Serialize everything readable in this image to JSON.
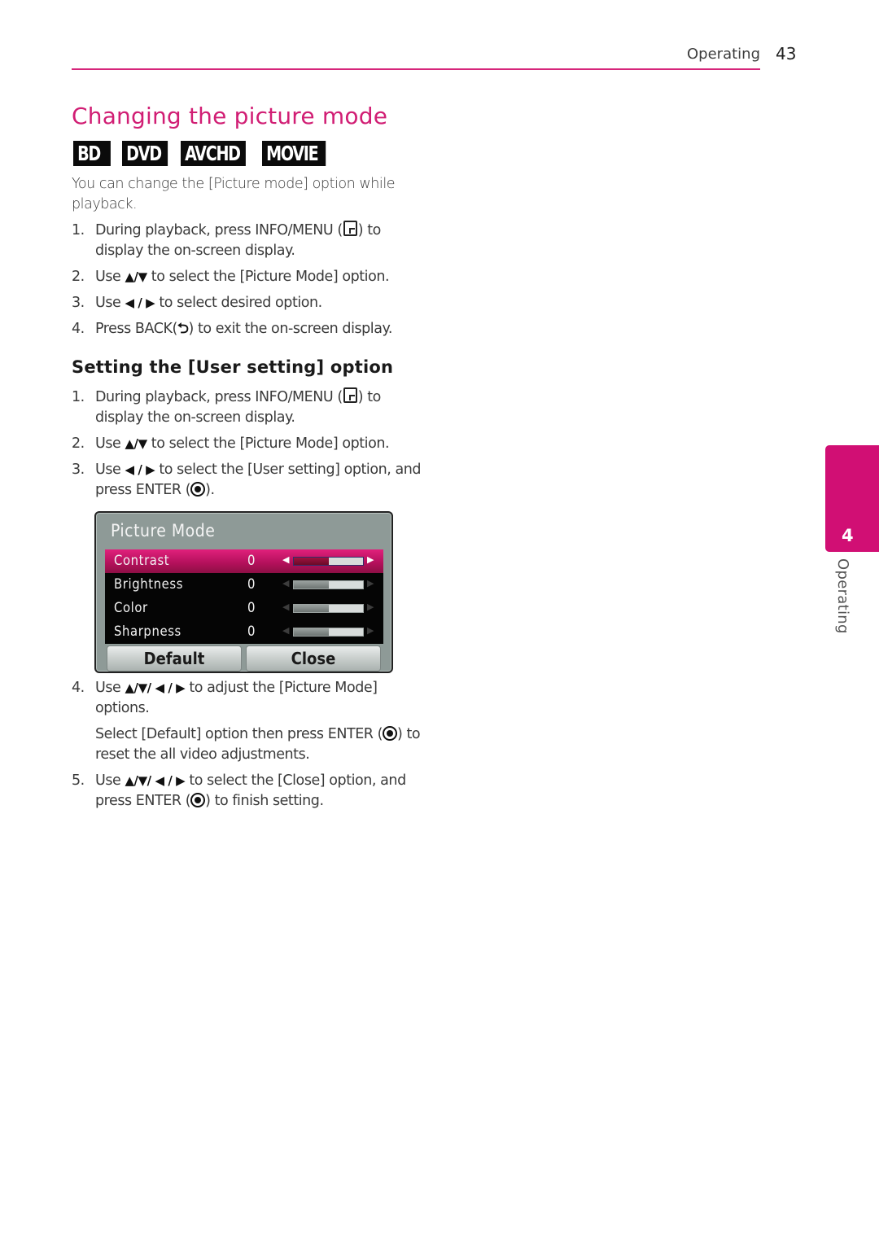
{
  "header": {
    "section": "Operating",
    "page_number": "43"
  },
  "title": "Changing the picture mode",
  "badges": [
    "BD",
    "DVD",
    "AVCHD",
    "MOVIE"
  ],
  "intro": "You can change the [Picture mode] option while playback.",
  "steps_1": [
    {
      "num": "1.",
      "pre": "During playback, press INFO/MENU (",
      "post": ") to display the on-screen display."
    },
    {
      "num": "2.",
      "pre": "Use ",
      "arrows": "▲/▼",
      "post": " to select the [Picture Mode] option."
    },
    {
      "num": "3.",
      "pre": "Use ",
      "arrows": "◀ / ▶",
      "post": " to select desired option."
    },
    {
      "num": "4.",
      "pre": "Press BACK(",
      "back_icon": "⮌",
      "post": ") to exit the on-screen display."
    }
  ],
  "subheading": "Setting the [User setting] option",
  "steps_2": [
    {
      "num": "1.",
      "pre": "During playback, press INFO/MENU (",
      "post": ") to display the on-screen display."
    },
    {
      "num": "2.",
      "pre": "Use ",
      "arrows": "▲/▼",
      "post": " to select the [Picture Mode] option."
    },
    {
      "num": "3.",
      "pre": "Use ",
      "arrows": "◀ / ▶",
      "post": " to select the [User setting] option, and press ENTER (",
      "post2": ")."
    }
  ],
  "osd": {
    "title": "Picture Mode",
    "rows": [
      {
        "label": "Contrast",
        "value": "0",
        "level": 0.5,
        "selected": true
      },
      {
        "label": "Brightness",
        "value": "0",
        "level": 0.5,
        "selected": false
      },
      {
        "label": "Color",
        "value": "0",
        "level": 0.5,
        "selected": false
      },
      {
        "label": "Sharpness",
        "value": "0",
        "level": 0.5,
        "selected": false
      }
    ],
    "left_arrow": "◀",
    "right_arrow": "▶",
    "default_button": "Default",
    "close_button": "Close"
  },
  "steps_3": [
    {
      "num": "4.",
      "pre": "Use ",
      "arrows": "▲/▼/ ◀ / ▶",
      "post": " to adjust the [Picture Mode] options.",
      "sub_pre": "Select [Default] option then press ENTER (",
      "sub_post": ") to reset the all video adjustments."
    },
    {
      "num": "5.",
      "pre": "Use ",
      "arrows": "▲/▼/ ◀ / ▶",
      "post": " to select the [Close] option, and press ENTER (",
      "post2": ") to finish setting."
    }
  ],
  "side_tab": {
    "chapter": "4",
    "label": "Operating"
  },
  "colors": {
    "accent": "#d11e74",
    "tab": "#d10f74"
  }
}
